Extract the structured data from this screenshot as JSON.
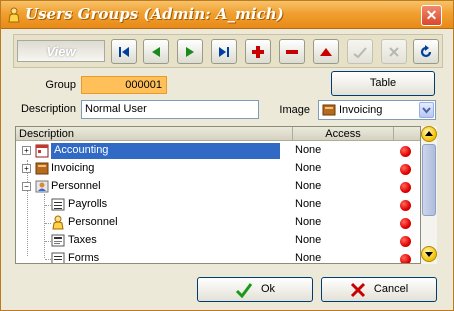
{
  "window": {
    "title": "Users Groups (Admin: A_mich)"
  },
  "toolbar": {
    "view_label": "View",
    "buttons": [
      "first-record",
      "previous-record",
      "next-record",
      "last-record",
      "add-record",
      "delete-record",
      "edit-record",
      "post-record",
      "cancel-edit",
      "refresh"
    ]
  },
  "form": {
    "group_label": "Group",
    "group_value": "000001",
    "description_label": "Description",
    "description_value": "Normal User",
    "table_button": "Table",
    "image_label": "Image",
    "image_value": "Invoicing"
  },
  "grid": {
    "columns": [
      "Description",
      "Access"
    ],
    "rows": [
      {
        "name": "Accounting",
        "access": "None",
        "selected": true
      },
      {
        "name": "Invoicing",
        "access": "None",
        "selected": false
      },
      {
        "name": "Personnel",
        "access": "None",
        "selected": false
      },
      {
        "name": "Payrolls",
        "access": "None",
        "selected": false
      },
      {
        "name": "Personnel",
        "access": "None",
        "selected": false
      },
      {
        "name": "Taxes",
        "access": "None",
        "selected": false
      },
      {
        "name": "Forms",
        "access": "None",
        "selected": false
      }
    ]
  },
  "footer": {
    "ok_label": "Ok",
    "cancel_label": "Cancel"
  },
  "colors": {
    "title_bar": "#f0a030",
    "selection": "#316ac5",
    "group_field": "#ffc05a",
    "status_dot": "#e00000"
  }
}
